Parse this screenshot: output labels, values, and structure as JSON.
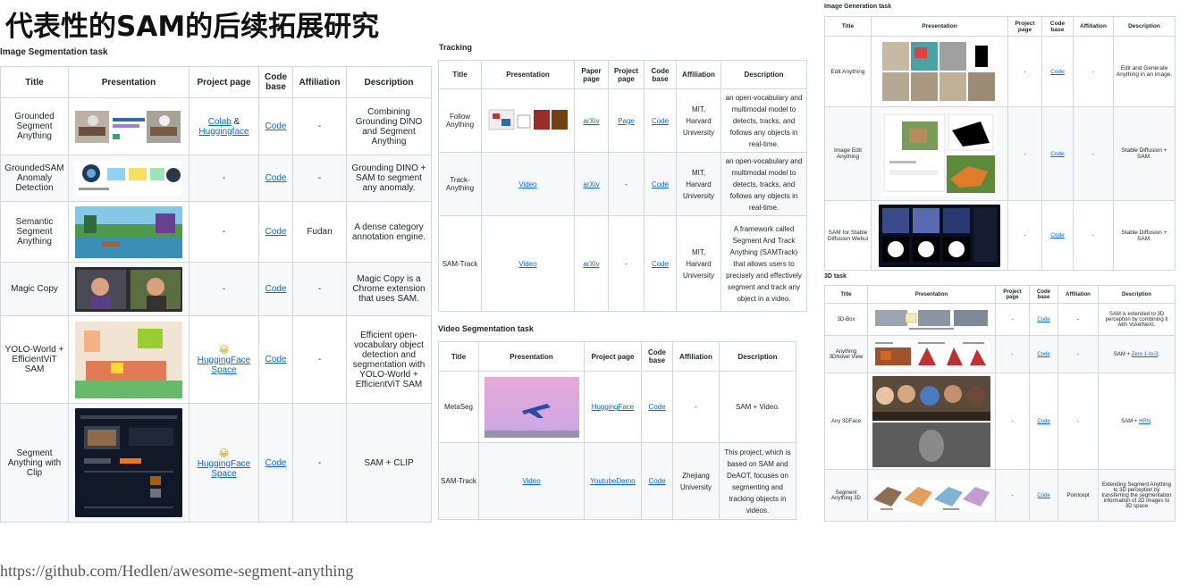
{
  "title": "代表性的SAM的后续拓展研究",
  "footer": "https://github.com/Hedlen/awesome-segment-anything",
  "image_seg": {
    "label": "Image Segmentation task",
    "headers": [
      "Title",
      "Presentation",
      "Project page",
      "Code base",
      "Affiliation",
      "Description"
    ],
    "rows": [
      {
        "title": "Grounded Segment Anything",
        "project": [
          "Colab",
          " & ",
          "Huggingface"
        ],
        "code": "Code",
        "affiliation": "-",
        "description": "Combining Grounding DINO and Segment Anything"
      },
      {
        "title": "GroundedSAM Anomaly Detection",
        "project": [
          "-"
        ],
        "code": "Code",
        "affiliation": "-",
        "description": "Grounding DINO + SAM to segment any anomaly."
      },
      {
        "title": "Semantic Segment Anything",
        "project": [
          "-"
        ],
        "code": "Code",
        "affiliation": "Fudan",
        "description": "A dense category annotation engine."
      },
      {
        "title": "Magic Copy",
        "project": [
          "-"
        ],
        "code": "Code",
        "affiliation": "-",
        "description": "Magic Copy is a Chrome extension that uses SAM."
      },
      {
        "title": "YOLO-World + EfficientViT SAM",
        "project": [
          "😀",
          "HuggingFace Space"
        ],
        "code": "Code",
        "affiliation": "-",
        "description": "Efficient open-vocabulary object detection and segmentation with YOLO-World + EfficientViT SAM"
      },
      {
        "title": "Segment Anything with Clip",
        "project": [
          "😀",
          "HuggingFace Space"
        ],
        "code": "Code",
        "affiliation": "-",
        "description": "SAM + CLIP"
      }
    ]
  },
  "tracking": {
    "label": "Tracking",
    "headers": [
      "Title",
      "Presentation",
      "Paper page",
      "Project page",
      "Code base",
      "Affiliation",
      "Description"
    ],
    "rows": [
      {
        "title": "Follow Anything",
        "paper": "arXiv",
        "project": "Page",
        "code": "Code",
        "affiliation": "MIT, Harvard University",
        "description": "an open-vocabulary and multimodal model to detects, tracks, and follows any objects in real-time."
      },
      {
        "title": "Track-Anything",
        "presentation": "Video",
        "paper": "arXiv",
        "project": "-",
        "code": "Code",
        "affiliation": "MIT, Harvard University",
        "description": "an open-vocabulary and multimodal model to detects, tracks, and follows any objects in real-time."
      },
      {
        "title": "SAM-Track",
        "presentation": "Video",
        "paper": "arXiv",
        "project": "-",
        "code": "Code",
        "affiliation": "MIT, Harvard University",
        "description": "A framework called Segment And Track Anything (SAMTrack) that allows users to precisely and effectively segment and track any object in a video."
      }
    ]
  },
  "video_seg": {
    "label": "Video Segmentation task",
    "headers": [
      "Title",
      "Presentation",
      "Project page",
      "Code base",
      "Affiliation",
      "Description"
    ],
    "rows": [
      {
        "title": "MetaSeg",
        "project": "HuggingFace",
        "code": "Code",
        "affiliation": "-",
        "description": "SAM + Video."
      },
      {
        "title": "SAM-Track",
        "presentation": "Video",
        "project": "YoutubeDemo",
        "code": "Code",
        "affiliation": "Zhejiang University",
        "description": "This project, which is based on SAM and DeAOT, focuses on segmenting and tracking objects in videos."
      }
    ]
  },
  "image_gen": {
    "label": "Image Generation task",
    "headers": [
      "Title",
      "Presentation",
      "Project page",
      "Code base",
      "Affiliation",
      "Description"
    ],
    "rows": [
      {
        "title": "Edit Anything",
        "project": "-",
        "code": "Code",
        "affiliation": "-",
        "description": "Edit and Generate Anything in an image."
      },
      {
        "title": "Image Edit Anything",
        "project": "-",
        "code": "Code",
        "affiliation": "-",
        "description": "Stable Diffusion + SAM."
      },
      {
        "title": "SAM for Stable Diffusion Webui",
        "project": "-",
        "code": "Code",
        "affiliation": "-",
        "description": "Stable Diffusion + SAM."
      }
    ]
  },
  "task3d": {
    "label": "3D task",
    "headers": [
      "Title",
      "Presentation",
      "Project page",
      "Code base",
      "Affiliation",
      "Description"
    ],
    "rows": [
      {
        "title": "3D-Box",
        "project": "-",
        "code": "Code",
        "affiliation": "-",
        "description": "SAM is extended to 3D perception by combining it with VoxelNeXt."
      },
      {
        "title": "Anything 3DNovel View",
        "project": "-",
        "code": "Code",
        "affiliation": "-",
        "description": [
          "SAM + ",
          "Zero 1-to-3",
          "."
        ]
      },
      {
        "title": "Any 3DFace",
        "project": "-",
        "code": "Code",
        "affiliation": "-",
        "description": [
          "SAM + ",
          "HRN",
          "."
        ]
      },
      {
        "title": "Segment Anything 3D",
        "project": "-",
        "code": "Code",
        "affiliation": "Pointcept",
        "description": "Extending Segment Anything to 3D perception by transferring the segmentation information of 2D images to 3D space"
      }
    ]
  }
}
